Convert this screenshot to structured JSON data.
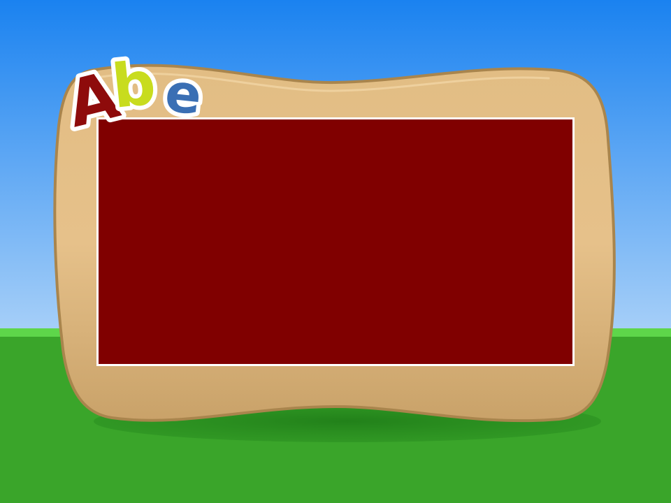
{
  "logo": {
    "letters": [
      {
        "char": "A",
        "color": "#8e0b0b"
      },
      {
        "char": "b",
        "color": "#c8dc1e"
      },
      {
        "char": "e",
        "color": "#3a6fb4"
      }
    ]
  },
  "colors": {
    "sky_top": "#1a82f0",
    "sky_bottom": "#a8d0f8",
    "grass": "#3aa52a",
    "grass_light": "#5ed64a",
    "board": "#dcb57c",
    "board_edge": "#a9854d",
    "screen": "#800000",
    "screen_border": "#ffffff"
  }
}
